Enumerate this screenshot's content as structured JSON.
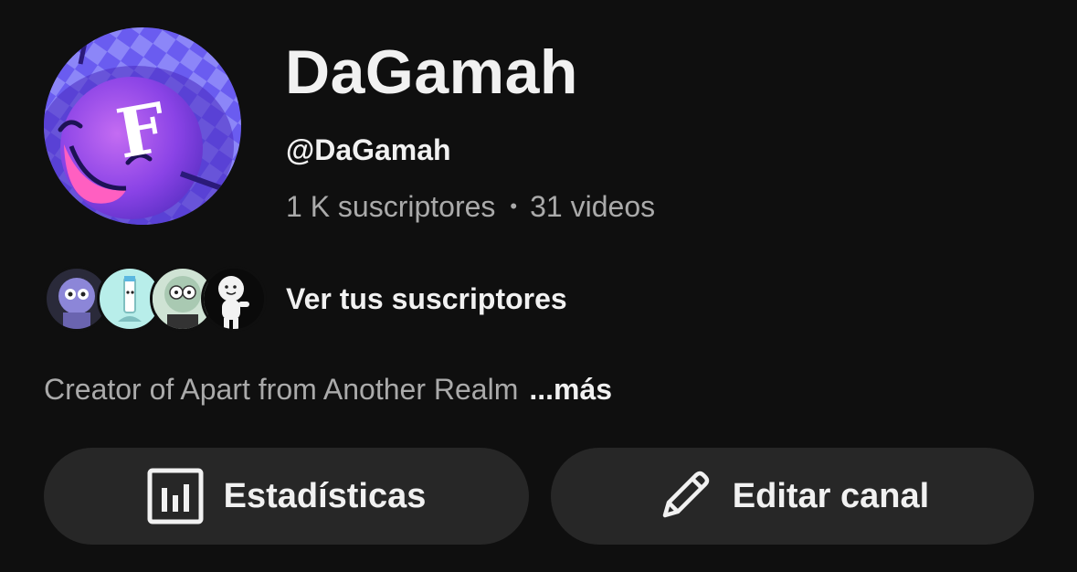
{
  "channel": {
    "name": "DaGamah",
    "handle": "@DaGamah",
    "subscribers": "1 K suscriptores",
    "separator": "•",
    "videos": "31 videos",
    "avatar_letter": "F"
  },
  "subscribers_link": {
    "label": "Ver tus suscriptores",
    "avatar_count": 4
  },
  "description": {
    "text": "Creator of Apart from Another Realm",
    "more_label": "...más"
  },
  "actions": {
    "stats_label": "Estadísticas",
    "stats_icon": "bar-chart-icon",
    "edit_label": "Editar canal",
    "edit_icon": "pencil-icon"
  },
  "colors": {
    "background": "#0f0f0f",
    "text_primary": "#f1f1f1",
    "text_secondary": "#aaaaaa",
    "button_bg": "#272727",
    "avatar_purple": "#7b4dff",
    "avatar_pink": "#e04fd3"
  }
}
